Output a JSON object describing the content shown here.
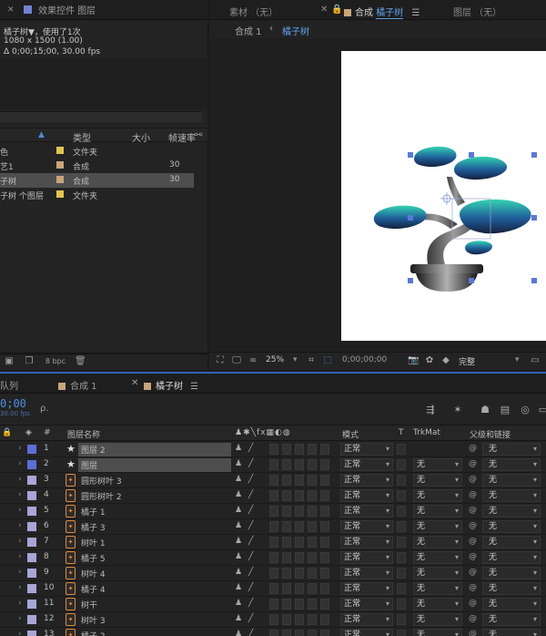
{
  "colors": {
    "accent_blue": "#2d63b9",
    "timecode_blue": "#4d8fe6",
    "label_blue": "#5b6fd8",
    "label_lavender": "#a7a6d6",
    "shape_orange": "#e08a3c",
    "folder_yellow": "#e2c64b",
    "comp_tan": "#c8a57a"
  },
  "project": {
    "tab_title": "效果控件 图层",
    "info": {
      "name_line": "橘子树▼，使用了1次",
      "size_line": "1080 x 1500 (1.00)",
      "duration_line": "Δ 0;00;15;00, 30.00 fps"
    },
    "columns": {
      "type": "类型",
      "size": "大小",
      "fps": "帧速率"
    },
    "rows": [
      {
        "name": "色",
        "type": "文件夹",
        "fps": "",
        "tag": "#e2c64b",
        "selected": false
      },
      {
        "name": "艺1",
        "type": "合成",
        "fps": "30",
        "tag": "#c8a57a",
        "selected": false
      },
      {
        "name": "子树",
        "type": "合成",
        "fps": "30",
        "tag": "#c8a57a",
        "selected": true
      },
      {
        "name": "子树 个图层",
        "type": "文件夹",
        "fps": "",
        "tag": "#e2c64b",
        "selected": false
      }
    ],
    "footer": {
      "bpc": "8 bpc"
    }
  },
  "viewer": {
    "tabs": {
      "footage": "素材 （无）",
      "comp_prefix": "合成",
      "comp_name": "橘子树",
      "layer": "图层 （无）"
    },
    "breadcrumbs": [
      "合成 1",
      "橘子树"
    ],
    "footer": {
      "zoom": "25%",
      "timecode": "0;00;00;00",
      "quality": "完整"
    }
  },
  "timeline": {
    "tabs": {
      "queue": "队列",
      "comp1": "合成 1",
      "comp2": "橘子树"
    },
    "timecode": "0;00",
    "timecode_sub": "30.00 fps",
    "search_placeholder": "ρ.",
    "columns": {
      "num": "#",
      "layer_name": "图层名称",
      "mode": "模式",
      "t": "T",
      "trkmat": "TrkMat",
      "parent": "父级和链接"
    },
    "layers": [
      {
        "num": "1",
        "name": "图层 2",
        "kind": "null",
        "label": "#5b6fd8",
        "mode": "正常",
        "trkmat": "",
        "parent": "无",
        "highlight": true
      },
      {
        "num": "2",
        "name": "图层",
        "kind": "null",
        "label": "#5b6fd8",
        "mode": "正常",
        "trkmat": "无",
        "parent": "无",
        "highlight": true
      },
      {
        "num": "3",
        "name": "圆形树叶 3",
        "kind": "shape",
        "label": "#a7a6d6",
        "mode": "正常",
        "trkmat": "无",
        "parent": "无",
        "highlight": false
      },
      {
        "num": "4",
        "name": "圆形树叶 2",
        "kind": "shape",
        "label": "#a7a6d6",
        "mode": "正常",
        "trkmat": "无",
        "parent": "无",
        "highlight": false
      },
      {
        "num": "5",
        "name": "橘子 1",
        "kind": "shape",
        "label": "#a7a6d6",
        "mode": "正常",
        "trkmat": "无",
        "parent": "无",
        "highlight": false
      },
      {
        "num": "6",
        "name": "橘子 3",
        "kind": "shape",
        "label": "#a7a6d6",
        "mode": "正常",
        "trkmat": "无",
        "parent": "无",
        "highlight": false
      },
      {
        "num": "7",
        "name": "树叶 1",
        "kind": "shape",
        "label": "#a7a6d6",
        "mode": "正常",
        "trkmat": "无",
        "parent": "无",
        "highlight": false
      },
      {
        "num": "8",
        "name": "橘子 5",
        "kind": "shape",
        "label": "#a7a6d6",
        "mode": "正常",
        "trkmat": "无",
        "parent": "无",
        "highlight": false
      },
      {
        "num": "9",
        "name": "树叶 4",
        "kind": "shape",
        "label": "#a7a6d6",
        "mode": "正常",
        "trkmat": "无",
        "parent": "无",
        "highlight": false
      },
      {
        "num": "10",
        "name": "橘子 4",
        "kind": "shape",
        "label": "#a7a6d6",
        "mode": "正常",
        "trkmat": "无",
        "parent": "无",
        "highlight": false
      },
      {
        "num": "11",
        "name": "树干",
        "kind": "shape",
        "label": "#a7a6d6",
        "mode": "正常",
        "trkmat": "无",
        "parent": "无",
        "highlight": false
      },
      {
        "num": "12",
        "name": "树叶 3",
        "kind": "shape",
        "label": "#a7a6d6",
        "mode": "正常",
        "trkmat": "无",
        "parent": "无",
        "highlight": false
      },
      {
        "num": "13",
        "name": "橘子 2",
        "kind": "shape",
        "label": "#a7a6d6",
        "mode": "正常",
        "trkmat": "无",
        "parent": "无",
        "highlight": false
      }
    ]
  }
}
